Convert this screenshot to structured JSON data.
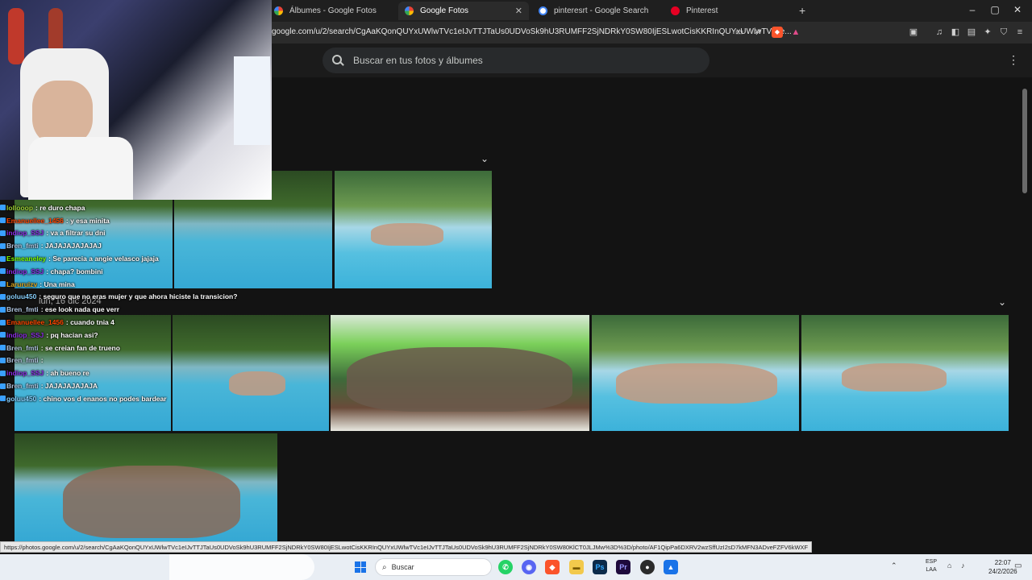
{
  "browser": {
    "tabs": [
      {
        "label": "Álbumes - Google Fotos",
        "active": false,
        "favicon_color": "#fbbc04"
      },
      {
        "label": "Google Fotos",
        "active": true,
        "favicon_color": "#34a853"
      },
      {
        "label": "pinteresrt - Google Search",
        "active": false,
        "favicon_color": "#ffffff"
      },
      {
        "label": "Pinterest",
        "active": false,
        "favicon_color": "#e60023"
      }
    ],
    "new_tab": "+",
    "url": "google.com/u/2/search/CgAaKQonQUYxUWlwTVc1eIJvTTJTaUs0UDVoSk9hU3RUMFF2SjNDRkY0SW80IjESLwotCisKKRInQUYxUWlwTVc1e...",
    "window_controls": [
      "–",
      "▢",
      "✕"
    ]
  },
  "photos": {
    "search_placeholder": "Buscar en tus fotos y álbumes",
    "date_label": "lun, 16 dic 2024"
  },
  "chat": [
    {
      "user": "lollooop",
      "text": ": re duro chapa",
      "color": "#9acd32"
    },
    {
      "user": "Emanuellee_1456",
      "text": ": y esa minita",
      "color": "#ff4500"
    },
    {
      "user": "indiop_SSJ",
      "text": ": va a filtrar su dni",
      "color": "#8a2be2"
    },
    {
      "user": "Bren_fmti",
      "text": ": JAJAJAJAJAJAJ",
      "color": "#b0c4de"
    },
    {
      "user": "Esmeaneley",
      "text": ": Se parecia a angie velasco jajaja",
      "color": "#7cfc00"
    },
    {
      "user": "indiop_SSJ",
      "text": ": chapa? bombini",
      "color": "#8a2be2"
    },
    {
      "user": "Laruruizv",
      "text": ": Una mina",
      "color": "#daa520"
    },
    {
      "user": "goluu450",
      "text": ": seguro que no eras mujer y que ahora hiciste la transicion?",
      "color": "#87cefa"
    },
    {
      "user": "Bren_fmti",
      "text": ": ese look nada que verr",
      "color": "#b0c4de"
    },
    {
      "user": "Emanuellee_1456",
      "text": ": cuando tnia 4",
      "color": "#ff4500"
    },
    {
      "user": "indiop_SSJ",
      "text": ": pq hacian asi?",
      "color": "#8a2be2"
    },
    {
      "user": "Bren_fmti",
      "text": ": se creian fan de trueno",
      "color": "#b0c4de"
    },
    {
      "user": "Bren_fmti",
      "text": ":",
      "color": "#b0c4de"
    },
    {
      "user": "indiop_SSJ",
      "text": ": ah bueno re",
      "color": "#8a2be2"
    },
    {
      "user": "Bren_fmti",
      "text": ": JAJAJAJAJAJA",
      "color": "#b0c4de"
    },
    {
      "user": "goluu450",
      "text": ": chino vos d enanos no podes bardear",
      "color": "#87cefa"
    }
  ],
  "status_url": "https://photos.google.com/u/2/search/CgAaKQonQUYxUWlwTVc1eIJvTTJTaUs0UDVoSk9hU3RUMFF2SjNDRkY0SW80IjESLwotCisKKRInQUYxUWlwTVc1eIJvTTJTaUs0UDVoSk9hU3RUMFF2SjNDRkY0SW80KlCT0JLJMw%3D%3D/photo/AF1QipPa6DXRV2wzSffUzI2sD7kMFN3ADveFZFV6kWXF",
  "taskbar": {
    "search_label": "Buscar",
    "lang": "ESP\nLAA",
    "time": "22:07",
    "date": "24/2/2026"
  },
  "colors": {
    "background": "#131313",
    "tab_bar": "#1f1f1f",
    "taskbar": "#e9eef4"
  }
}
